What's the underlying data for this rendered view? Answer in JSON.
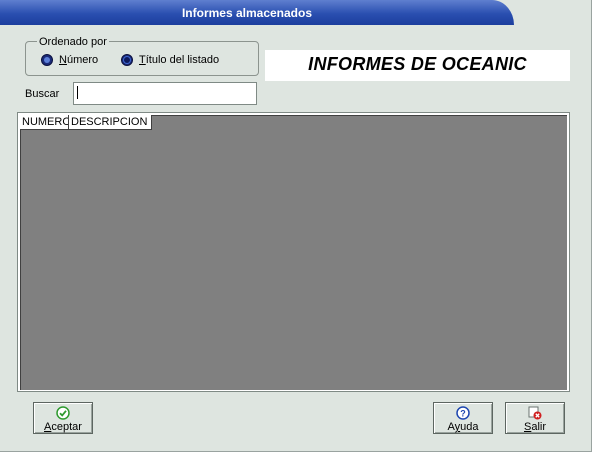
{
  "window": {
    "title": "Informes almacenados"
  },
  "sort_group": {
    "legend": "Ordenado por",
    "options": [
      {
        "mnemonic": "N",
        "rest": "úmero",
        "selected": false
      },
      {
        "mnemonic": "T",
        "rest": "ítulo del listado",
        "selected": true
      }
    ]
  },
  "banner": {
    "text": "INFORMES DE OCEANIC"
  },
  "search": {
    "label": "Buscar",
    "value": ""
  },
  "table": {
    "columns": [
      "NUMERO",
      "DESCRIPCION"
    ],
    "rows": []
  },
  "buttons": {
    "accept": {
      "mnemonic": "A",
      "rest": "ceptar",
      "icon": "check-icon",
      "color": "#2f9a2f"
    },
    "help": {
      "before": "A",
      "mnemonic": "y",
      "rest": "uda",
      "icon": "help-icon",
      "color": "#1f47b0"
    },
    "exit": {
      "mnemonic": "S",
      "rest": "alir",
      "icon": "exit-icon",
      "color": "#d01f1f"
    }
  }
}
